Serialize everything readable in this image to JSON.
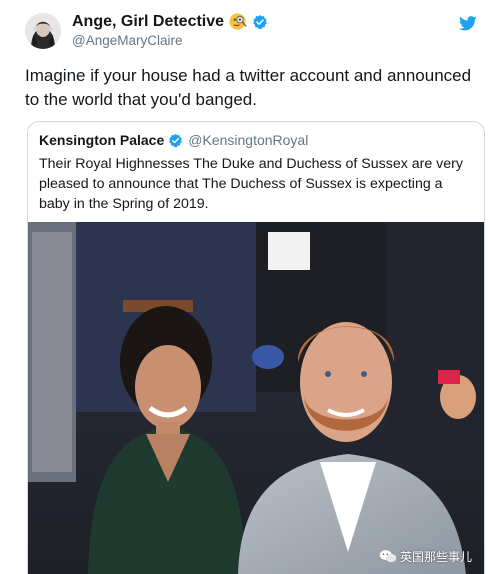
{
  "tweet": {
    "author": {
      "display_name": "Ange, Girl Detective",
      "emoji": "magnifying-glass-face-emoji",
      "handle": "@AngeMaryClaire",
      "verified": true
    },
    "text": "Imagine if your house had a twitter account and announced to the world that you'd banged.",
    "quoted": {
      "author": {
        "display_name": "Kensington Palace",
        "handle": "@KensingtonRoyal",
        "verified": true
      },
      "text": "Their Royal Highnesses The Duke and Duchess of Sussex are very pleased to announce that The Duchess of Sussex is expecting a baby in the Spring of 2019.",
      "photo": {
        "description_icon": "photo"
      }
    }
  },
  "watermark": {
    "text": "英国那些事儿"
  },
  "colors": {
    "twitter_blue": "#1da1f2",
    "text": "#14171a",
    "secondary_text": "#657786",
    "border": "#cfd9de"
  }
}
